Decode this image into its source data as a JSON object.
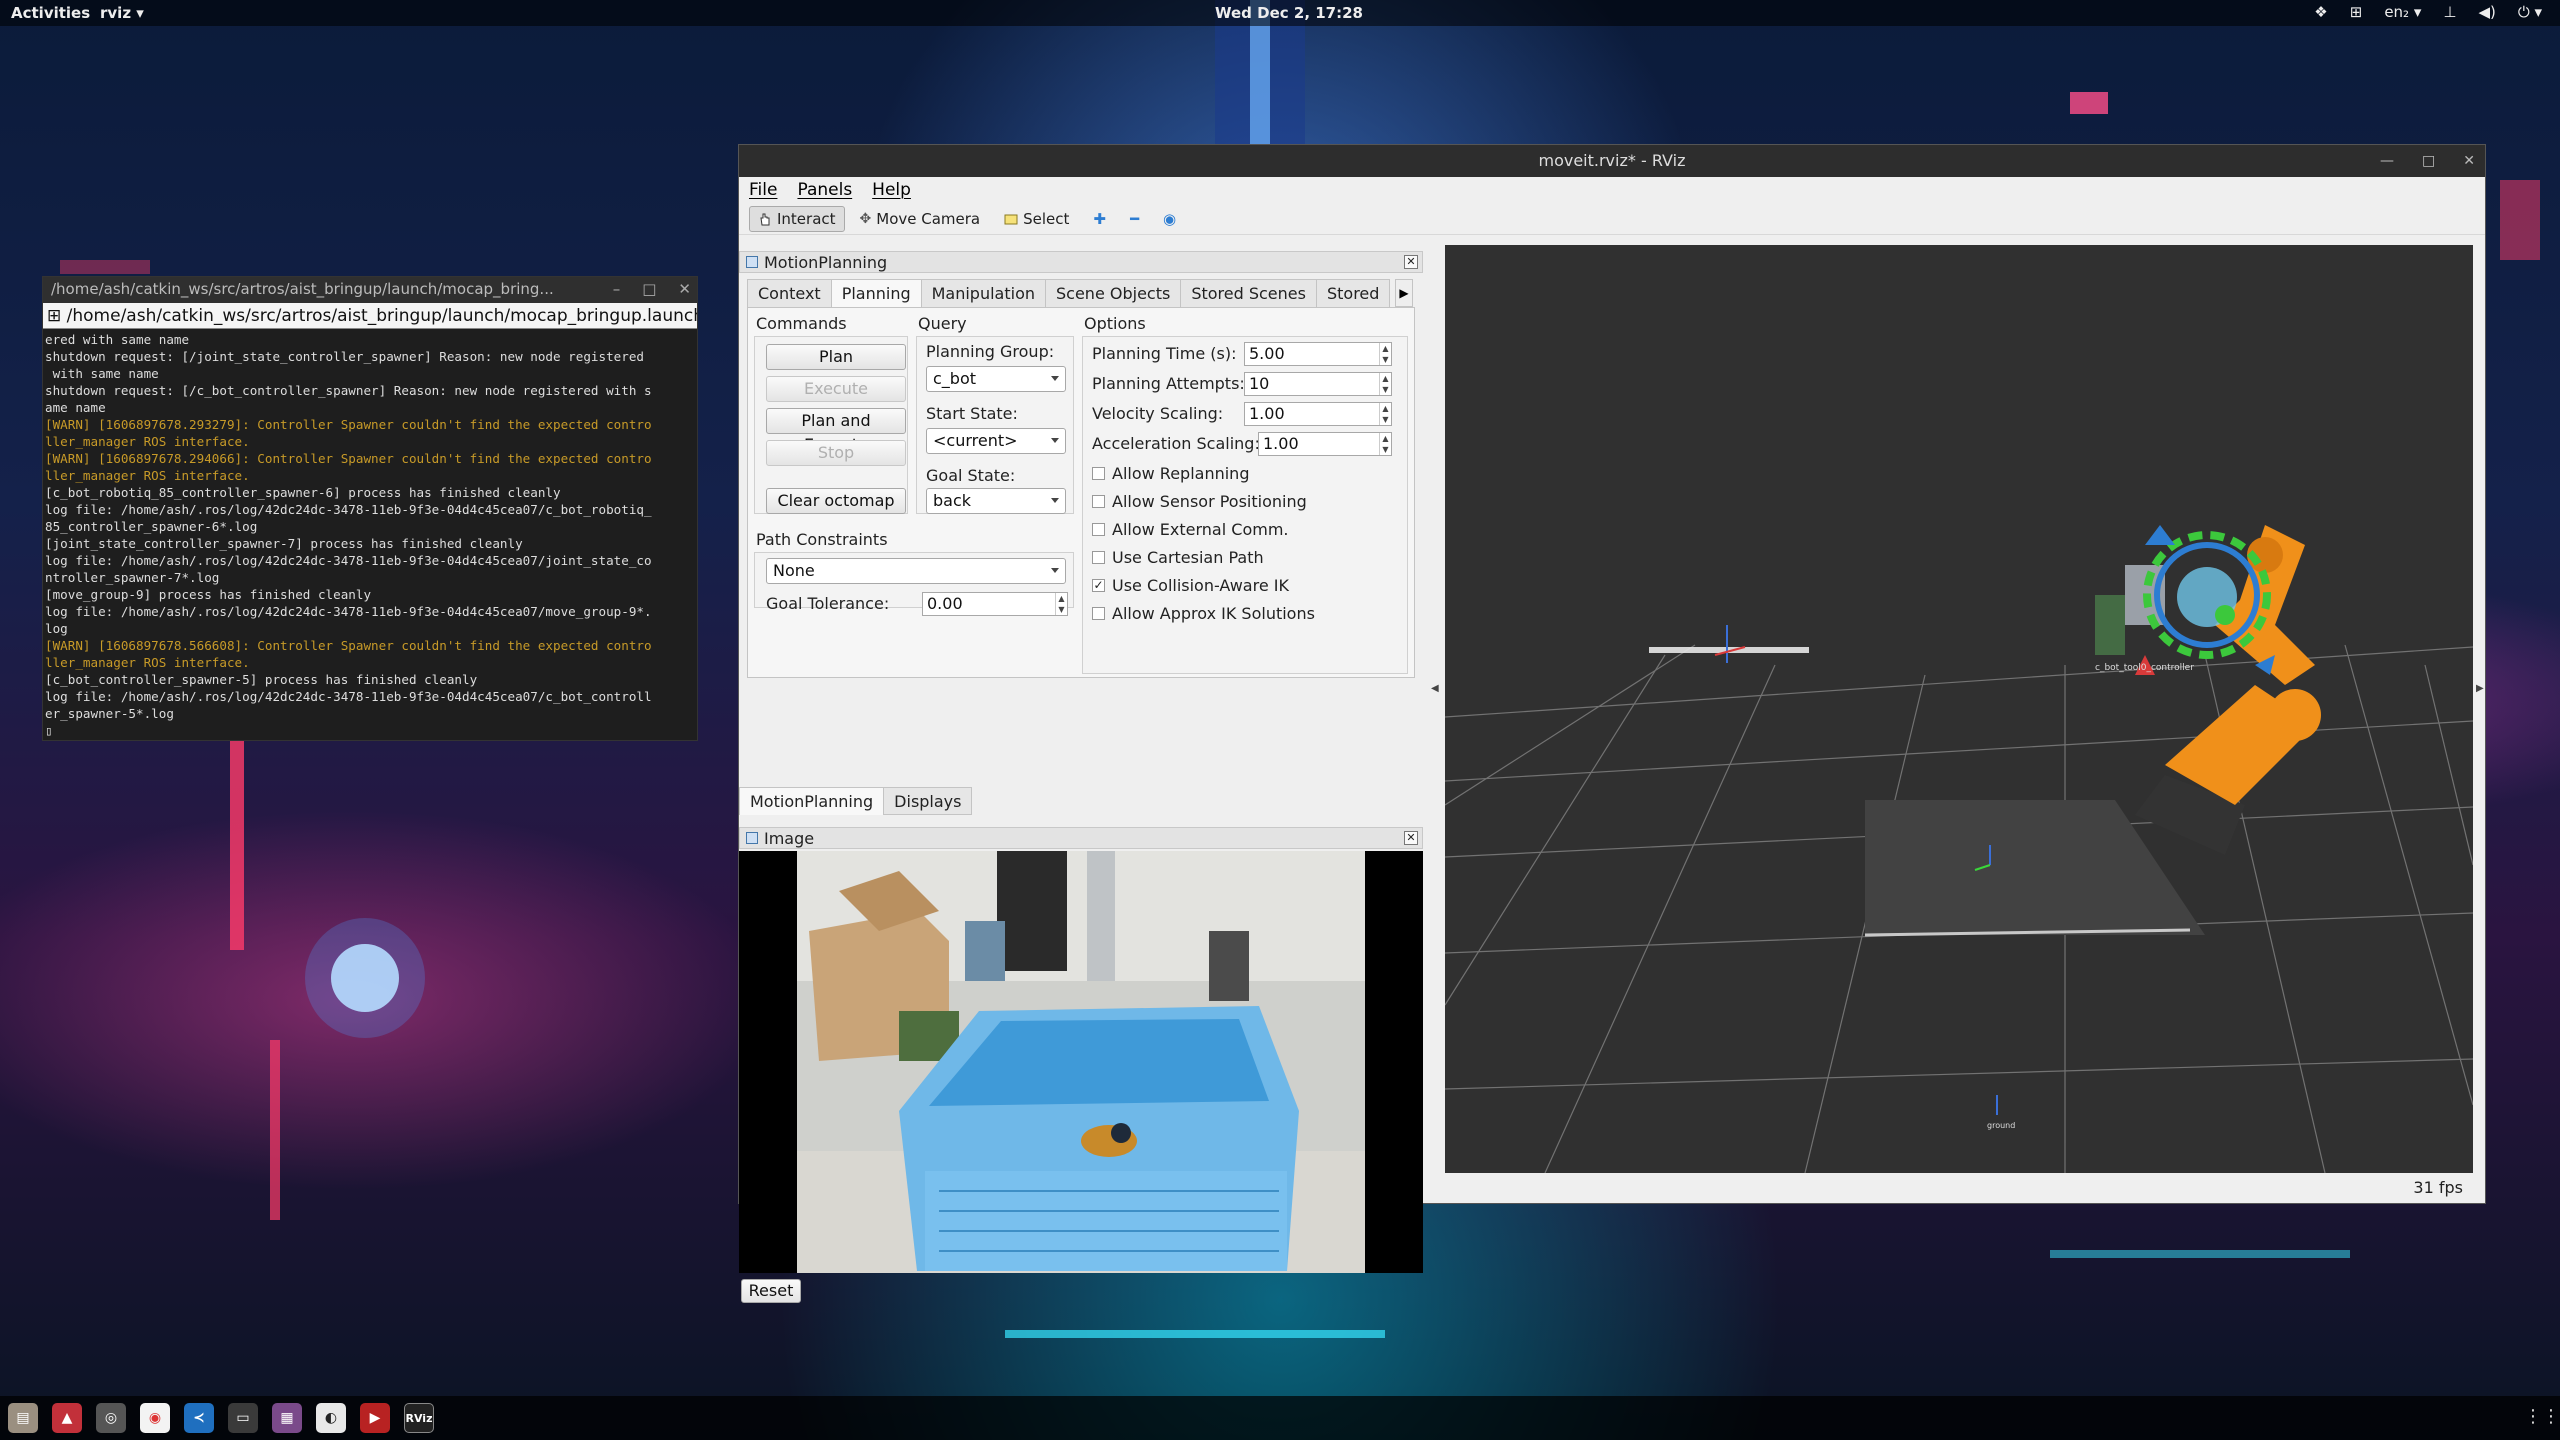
{
  "topbar": {
    "activities": "Activities",
    "app_menu": "rviz ▾",
    "clock": "Wed Dec 2, 17:28",
    "lang": "en₂ ▾",
    "icons": [
      "dropbox-icon",
      "grid-icon",
      "network-icon",
      "volume-icon",
      "power-icon"
    ]
  },
  "terminal": {
    "title": "/home/ash/catkin_ws/src/artros/aist_bringup/launch/mocap_bring...",
    "tab": "/home/ash/catkin_ws/src/artros/aist_bringup/launch/mocap_bringup.launch htt",
    "lines": [
      {
        "t": "ered with same name",
        "c": ""
      },
      {
        "t": "shutdown request: [/joint_state_controller_spawner] Reason: new node registered",
        "c": ""
      },
      {
        "t": " with same name",
        "c": ""
      },
      {
        "t": "shutdown request: [/c_bot_controller_spawner] Reason: new node registered with s",
        "c": ""
      },
      {
        "t": "ame name",
        "c": ""
      },
      {
        "t": "[WARN] [1606897678.293279]: Controller Spawner couldn't find the expected contro",
        "c": "warn"
      },
      {
        "t": "ller_manager ROS interface.",
        "c": "warn"
      },
      {
        "t": "[WARN] [1606897678.294066]: Controller Spawner couldn't find the expected contro",
        "c": "warn"
      },
      {
        "t": "ller_manager ROS interface.",
        "c": "warn"
      },
      {
        "t": "[c_bot_robotiq_85_controller_spawner-6] process has finished cleanly",
        "c": ""
      },
      {
        "t": "log file: /home/ash/.ros/log/42dc24dc-3478-11eb-9f3e-04d4c45cea07/c_bot_robotiq_",
        "c": ""
      },
      {
        "t": "85_controller_spawner-6*.log",
        "c": ""
      },
      {
        "t": "[joint_state_controller_spawner-7] process has finished cleanly",
        "c": ""
      },
      {
        "t": "log file: /home/ash/.ros/log/42dc24dc-3478-11eb-9f3e-04d4c45cea07/joint_state_co",
        "c": ""
      },
      {
        "t": "ntroller_spawner-7*.log",
        "c": ""
      },
      {
        "t": "[move_group-9] process has finished cleanly",
        "c": ""
      },
      {
        "t": "log file: /home/ash/.ros/log/42dc24dc-3478-11eb-9f3e-04d4c45cea07/move_group-9*.",
        "c": ""
      },
      {
        "t": "log",
        "c": ""
      },
      {
        "t": "[WARN] [1606897678.566608]: Controller Spawner couldn't find the expected contro",
        "c": "warn"
      },
      {
        "t": "ller_manager ROS interface.",
        "c": "warn"
      },
      {
        "t": "[c_bot_controller_spawner-5] process has finished cleanly",
        "c": ""
      },
      {
        "t": "log file: /home/ash/.ros/log/42dc24dc-3478-11eb-9f3e-04d4c45cea07/c_bot_controll",
        "c": ""
      },
      {
        "t": "er_spawner-5*.log",
        "c": ""
      },
      {
        "t": "▯",
        "c": ""
      }
    ]
  },
  "rviz": {
    "window_title": "moveit.rviz* - RViz",
    "menu": [
      "File",
      "Panels",
      "Help"
    ],
    "toolbar": {
      "interact": "Interact",
      "move_camera": "Move Camera",
      "select": "Select"
    },
    "motion_panel": {
      "title": "MotionPlanning",
      "tabs": [
        "Context",
        "Planning",
        "Manipulation",
        "Scene Objects",
        "Stored Scenes",
        "Stored"
      ],
      "commands": {
        "title": "Commands",
        "plan": "Plan",
        "execute": "Execute",
        "plan_execute": "Plan and Execute",
        "stop": "Stop",
        "clear_octomap": "Clear octomap"
      },
      "query": {
        "title": "Query",
        "planning_group_label": "Planning Group:",
        "planning_group": "c_bot",
        "start_state_label": "Start State:",
        "start_state": "<current>",
        "goal_state_label": "Goal State:",
        "goal_state": "back"
      },
      "options": {
        "title": "Options",
        "planning_time_label": "Planning Time (s):",
        "planning_time": "5.00",
        "planning_attempts_label": "Planning Attempts:",
        "planning_attempts": "10",
        "velocity_label": "Velocity Scaling:",
        "velocity": "1.00",
        "accel_label": "Acceleration Scaling:",
        "accel": "1.00",
        "checks": [
          {
            "label": "Allow Replanning",
            "checked": false
          },
          {
            "label": "Allow Sensor Positioning",
            "checked": false
          },
          {
            "label": "Allow External Comm.",
            "checked": false
          },
          {
            "label": "Use Cartesian Path",
            "checked": false
          },
          {
            "label": "Use Collision-Aware IK",
            "checked": true
          },
          {
            "label": "Allow Approx IK Solutions",
            "checked": false
          }
        ]
      },
      "path_constraints": {
        "title": "Path Constraints",
        "value": "None",
        "goal_tolerance_label": "Goal Tolerance:",
        "goal_tolerance": "0.00"
      },
      "bottom_tabs": [
        "MotionPlanning",
        "Displays"
      ]
    },
    "image_panel": {
      "title": "Image"
    },
    "reset": "Reset",
    "fps": "31 fps",
    "view3d": {
      "ee_label": "c_bot_tool0_controller",
      "ground_label": "ground"
    }
  },
  "dock": {
    "items": [
      "files-icon",
      "matlab-icon",
      "camera-icon",
      "chrome-icon",
      "vscode-icon",
      "terminal-icon",
      "system-monitor-icon",
      "steam-icon",
      "video-icon",
      "rviz-icon"
    ],
    "rviz_text": "RViz"
  },
  "colors": {
    "robot_orange": "#f0901a",
    "accent_blue": "#2d7dd2",
    "ring_green": "#3cc83c"
  }
}
